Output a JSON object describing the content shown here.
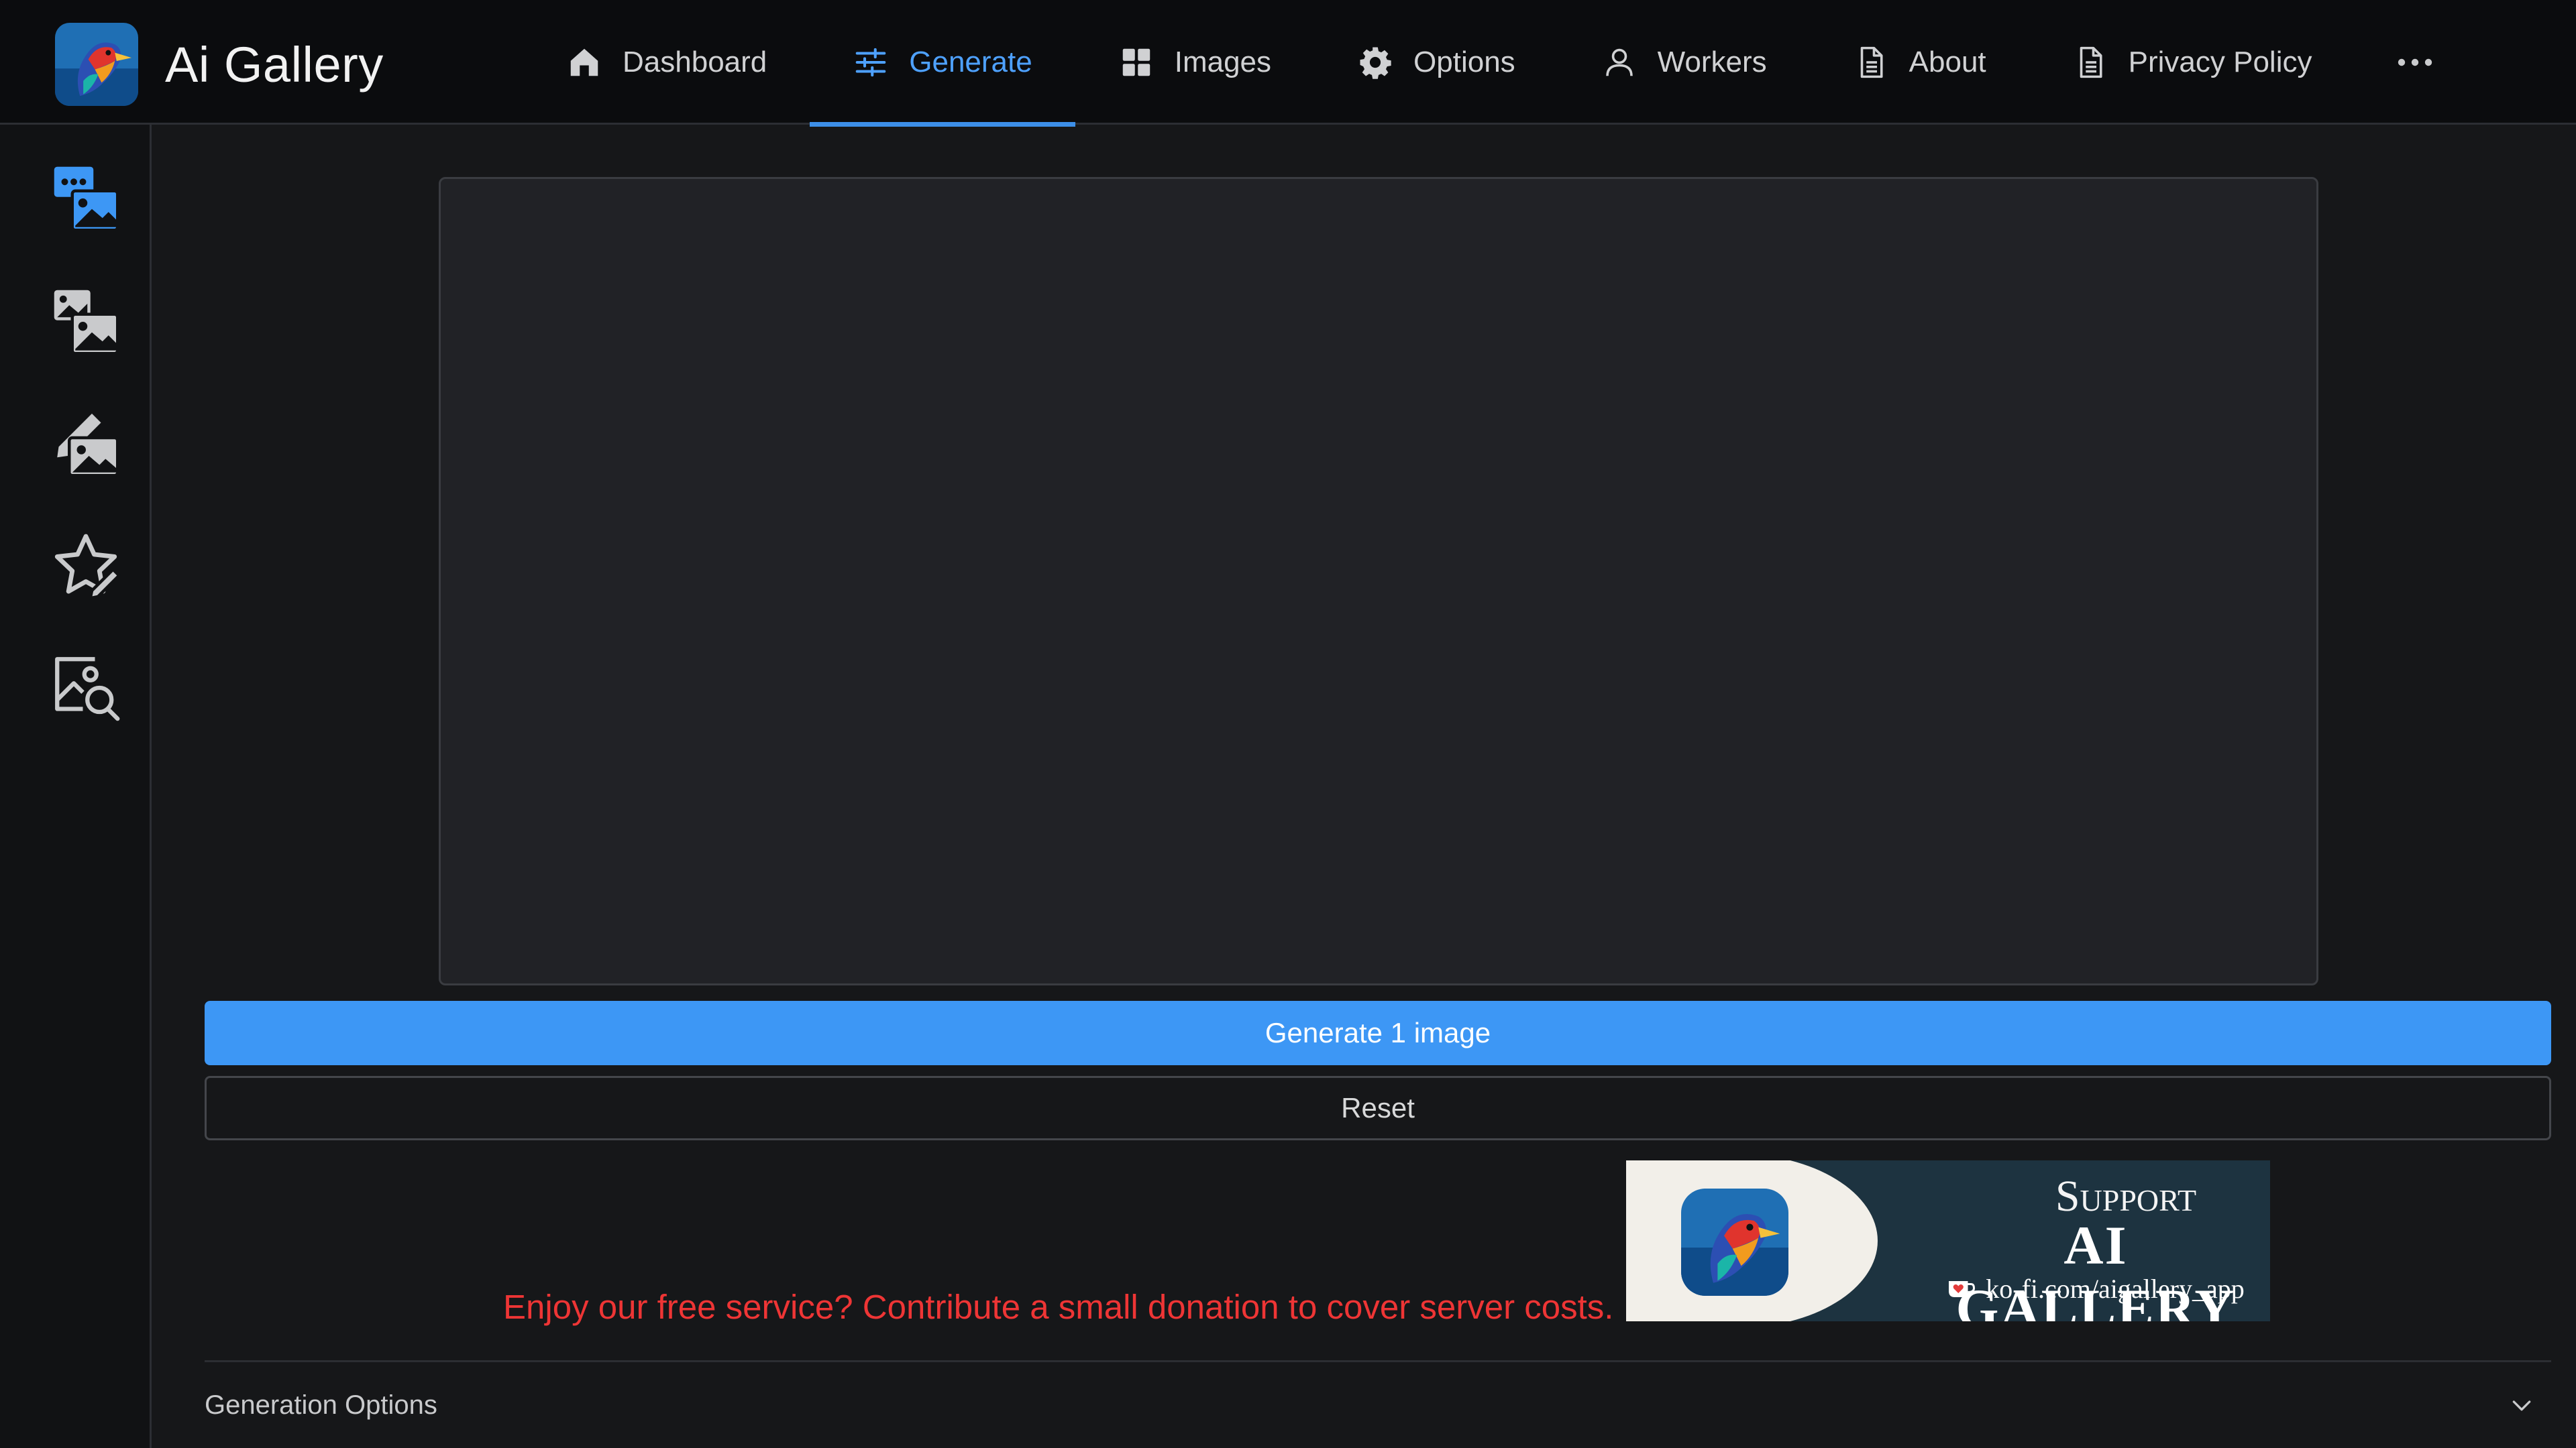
{
  "app": {
    "title": "Ai Gallery"
  },
  "nav": {
    "items": [
      {
        "label": "Dashboard",
        "icon": "home-icon"
      },
      {
        "label": "Generate",
        "icon": "sliders-icon",
        "active": true
      },
      {
        "label": "Images",
        "icon": "grid-icon"
      },
      {
        "label": "Options",
        "icon": "gear-icon"
      },
      {
        "label": "Workers",
        "icon": "user-icon"
      },
      {
        "label": "About",
        "icon": "document-icon"
      },
      {
        "label": "Privacy Policy",
        "icon": "document-icon"
      }
    ],
    "more_icon": "more-dots-icon"
  },
  "sidebar": {
    "items": [
      {
        "icon": "text-to-image-icon",
        "active": true
      },
      {
        "icon": "image-to-image-icon"
      },
      {
        "icon": "inpainting-icon"
      },
      {
        "icon": "star-edit-icon"
      },
      {
        "icon": "image-search-icon"
      }
    ]
  },
  "main": {
    "generate_label": "Generate 1 image",
    "reset_label": "Reset",
    "donation_text": "Enjoy our free service? Contribute a small donation to cover server costs.",
    "banner": {
      "support": "Support",
      "name": "AI GALLERY",
      "url": "ko-fi.com/aigallery_app"
    },
    "generation_options_label": "Generation Options"
  },
  "colors": {
    "accent": "#3d97f5",
    "active_nav": "#4ea1ff",
    "donation_text": "#ee3535",
    "background": "#161719",
    "topbar": "#0b0c0e"
  }
}
